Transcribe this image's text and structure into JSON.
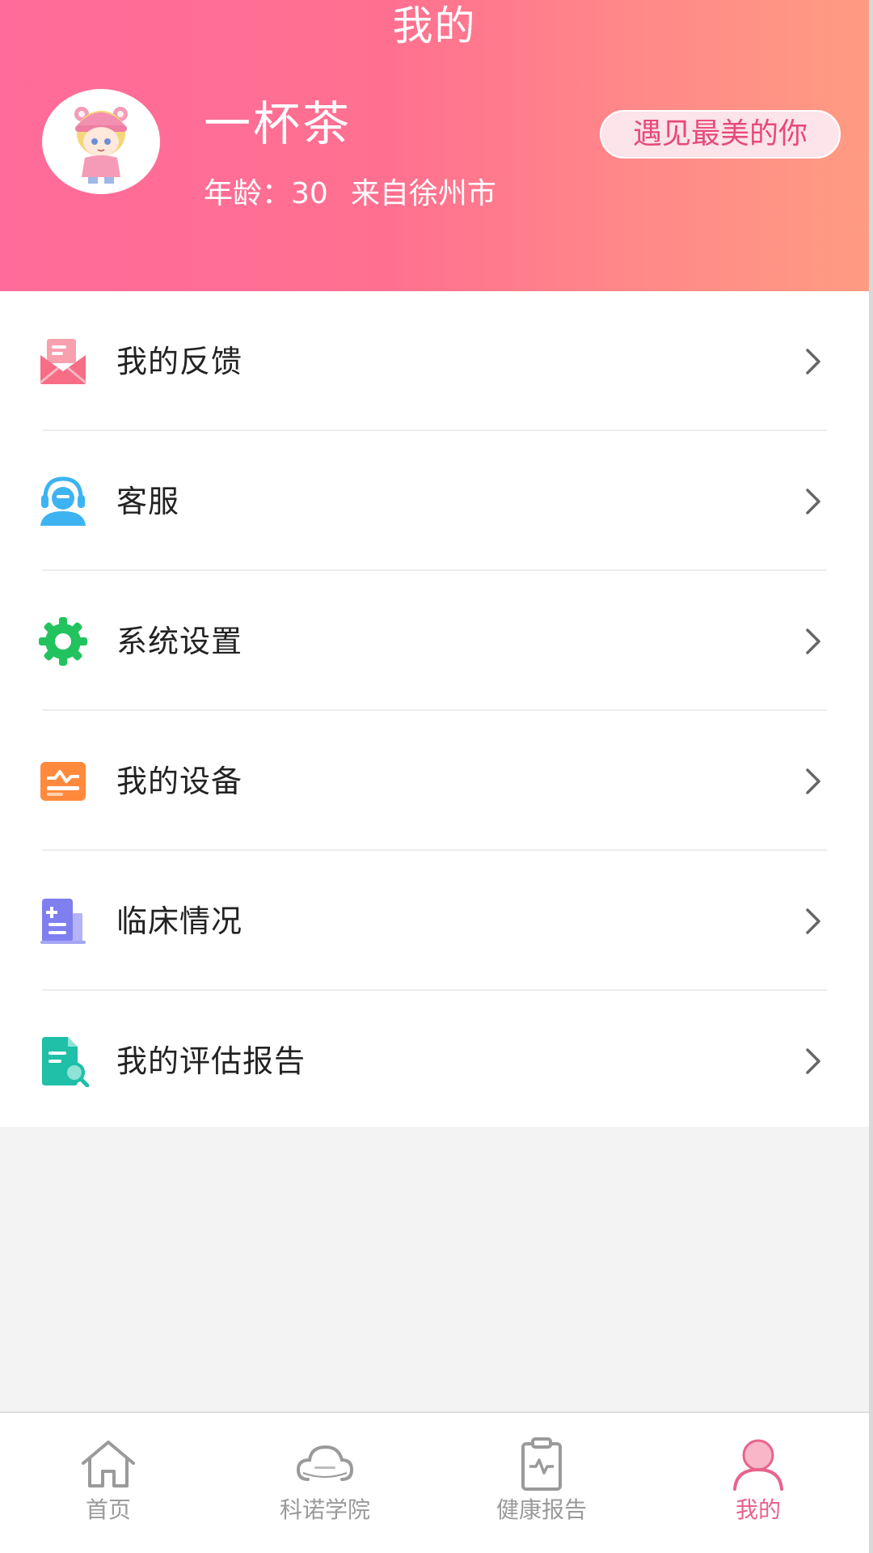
{
  "header": {
    "title": "我的",
    "user_name": "一杯茶",
    "age_label": "年龄：",
    "age_value": "30",
    "location": "来自徐州市",
    "tag_button": "遇见最美的你"
  },
  "menu": {
    "items": [
      {
        "label": "我的反馈",
        "icon": "feedback-mail-icon",
        "color": "#f76d86"
      },
      {
        "label": "客服",
        "icon": "customer-service-headset-icon",
        "color": "#3db3f2"
      },
      {
        "label": "系统设置",
        "icon": "gear-icon",
        "color": "#22c35e"
      },
      {
        "label": "我的设备",
        "icon": "device-monitor-icon",
        "color": "#ff8a3d"
      },
      {
        "label": "临床情况",
        "icon": "medical-document-icon",
        "color": "#7f7ff0"
      },
      {
        "label": "我的评估报告",
        "icon": "report-search-icon",
        "color": "#1fbfa8"
      }
    ]
  },
  "tabbar": {
    "tabs": [
      {
        "label": "首页",
        "icon": "home-icon",
        "active": false
      },
      {
        "label": "科诺学院",
        "icon": "cloud-icon",
        "active": false
      },
      {
        "label": "健康报告",
        "icon": "clipboard-heartbeat-icon",
        "active": false
      },
      {
        "label": "我的",
        "icon": "person-icon",
        "active": true
      }
    ],
    "active_color": "#e8638d",
    "inactive_color": "#9a9a9a"
  }
}
